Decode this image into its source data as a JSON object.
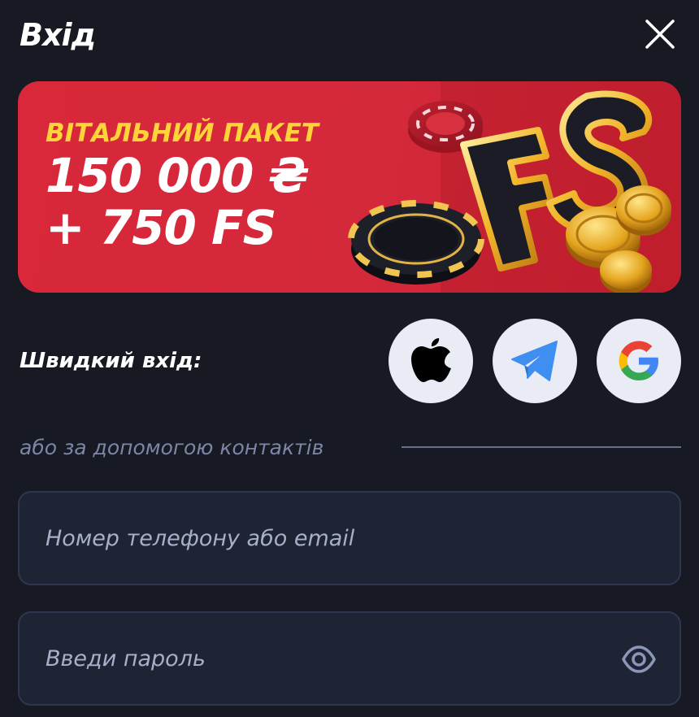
{
  "header": {
    "title": "Вхід",
    "close_icon": "close-icon"
  },
  "banner": {
    "subtitle": "ВІТАЛЬНИЙ ПАКЕТ",
    "amount": "150 000 ₴",
    "free_spins": "+ 750 FS",
    "art_letters": "FS",
    "colors": {
      "background": "#d4293b",
      "subtitle": "#ffd33a",
      "text": "#ffffff"
    }
  },
  "quick_login": {
    "label": "Швидкий вхід:",
    "providers": [
      {
        "name": "Apple",
        "icon": "apple-icon"
      },
      {
        "name": "Telegram",
        "icon": "telegram-icon"
      },
      {
        "name": "Google",
        "icon": "google-icon"
      }
    ]
  },
  "contacts_divider": {
    "text": "або за допомогою контактів"
  },
  "form": {
    "login": {
      "placeholder": "Номер телефону або email",
      "value": ""
    },
    "password": {
      "placeholder": "Введи пароль",
      "value": "",
      "toggle_icon": "eye-icon"
    }
  },
  "theme": {
    "background": "#171923",
    "field_background": "#1f2434",
    "field_border": "#2e3650",
    "muted_text": "#7d86a6",
    "social_button": "#e9ecf4",
    "telegram_blue": "#3f8ef1"
  }
}
